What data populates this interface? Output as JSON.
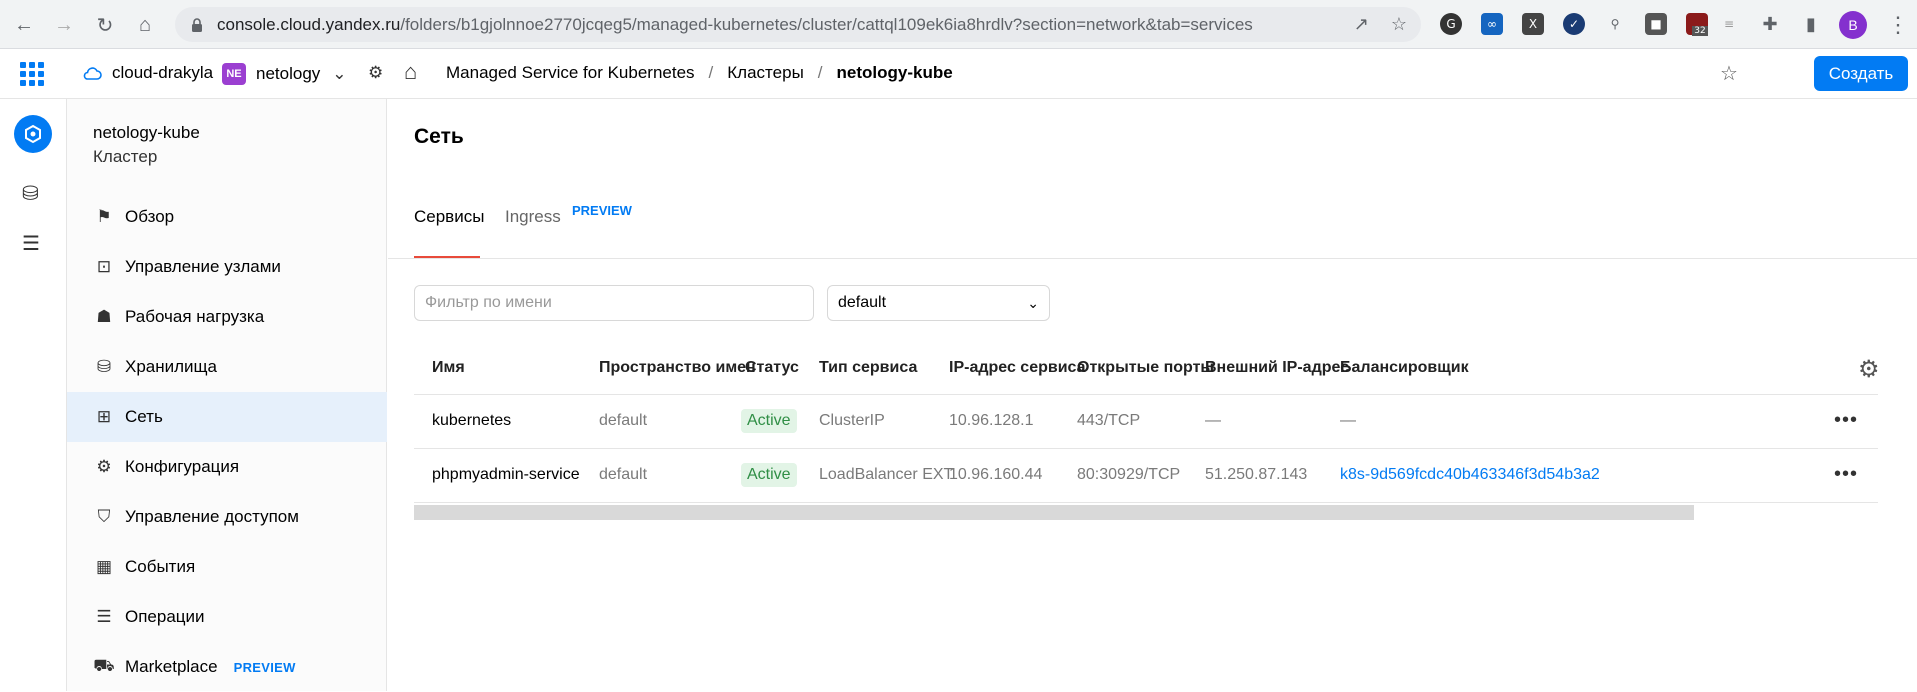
{
  "browser": {
    "url_host": "console.cloud.yandex.ru",
    "url_path": "/folders/b1gjolnnoe2770jcqeg5/managed-kubernetes/cluster/cattql109ek6ia8hrdlv?section=network&tab=services",
    "avatar_letter": "B",
    "ext_badge": "32"
  },
  "topbar": {
    "cloud": "cloud-drakyla",
    "folder_badge": "NE",
    "folder": "netology",
    "breadcrumbs": [
      "Managed Service for Kubernetes",
      "Кластеры",
      "netology-kube"
    ],
    "create_label": "Создать"
  },
  "sidebar": {
    "title": "netology-kube",
    "subtitle": "Кластер",
    "items": [
      {
        "label": "Обзор",
        "icon": "flag-icon"
      },
      {
        "label": "Управление узлами",
        "icon": "nodes-icon"
      },
      {
        "label": "Рабочая нагрузка",
        "icon": "worker-icon"
      },
      {
        "label": "Хранилища",
        "icon": "database-icon"
      },
      {
        "label": "Сеть",
        "icon": "network-icon"
      },
      {
        "label": "Конфигурация",
        "icon": "gears-icon"
      },
      {
        "label": "Управление доступом",
        "icon": "shield-icon"
      },
      {
        "label": "События",
        "icon": "calendar-icon"
      },
      {
        "label": "Операции",
        "icon": "list-icon"
      },
      {
        "label": "Marketplace",
        "icon": "cart-icon",
        "tag": "PREVIEW"
      }
    ]
  },
  "main": {
    "title": "Сеть",
    "tabs": [
      {
        "label": "Сервисы"
      },
      {
        "label": "Ingress",
        "tag": "PREVIEW"
      }
    ],
    "filter_placeholder": "Фильтр по имени",
    "namespace": "default",
    "columns": [
      "Имя",
      "Пространство имен",
      "Статус",
      "Тип сервиса",
      "IP-адрес сервиса",
      "Открытые порты",
      "Внешний IP-адрес",
      "Балансировщик"
    ],
    "rows": [
      {
        "name": "kubernetes",
        "namespace": "default",
        "status": "Active",
        "type": "ClusterIP",
        "ip": "10.96.128.1",
        "ports": "443/TCP",
        "external_ip": "—",
        "balancer": "—"
      },
      {
        "name": "phpmyadmin-service",
        "namespace": "default",
        "status": "Active",
        "type": "LoadBalancer EXT",
        "ip": "10.96.160.44",
        "ports": "80:30929/TCP",
        "external_ip": "51.250.87.143",
        "balancer": "k8s-9d569fcdc40b463346f3d54b3a2"
      }
    ]
  },
  "colors": {
    "accent": "#027bf3",
    "active_bg": "#e2f4e6",
    "active_text": "#2f8e45",
    "tab_underline": "#e84a3a"
  }
}
